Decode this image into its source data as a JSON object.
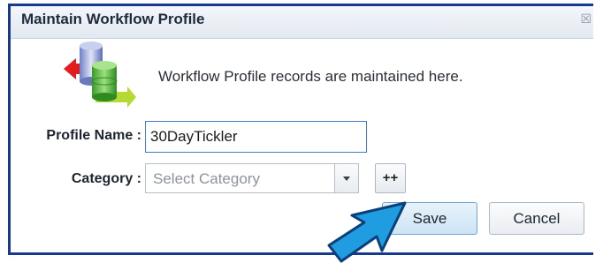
{
  "dialog": {
    "title": "Maintain Workflow Profile",
    "close_glyph": "☒",
    "icon": "database-sync-icon",
    "description": "Workflow Profile records are maintained here."
  },
  "form": {
    "profile_name": {
      "label": "Profile Name :",
      "value": "30DayTickler"
    },
    "category": {
      "label": "Category :",
      "placeholder": "Select Category",
      "value": ""
    },
    "add_category_label": "++"
  },
  "buttons": {
    "save_label": "Save",
    "cancel_label": "Cancel"
  },
  "colors": {
    "frame_border": "#173a8e",
    "focus_border": "#3f7bc6",
    "save_fill": "#cde4f4",
    "pointer_arrow": "#1f9de0"
  }
}
